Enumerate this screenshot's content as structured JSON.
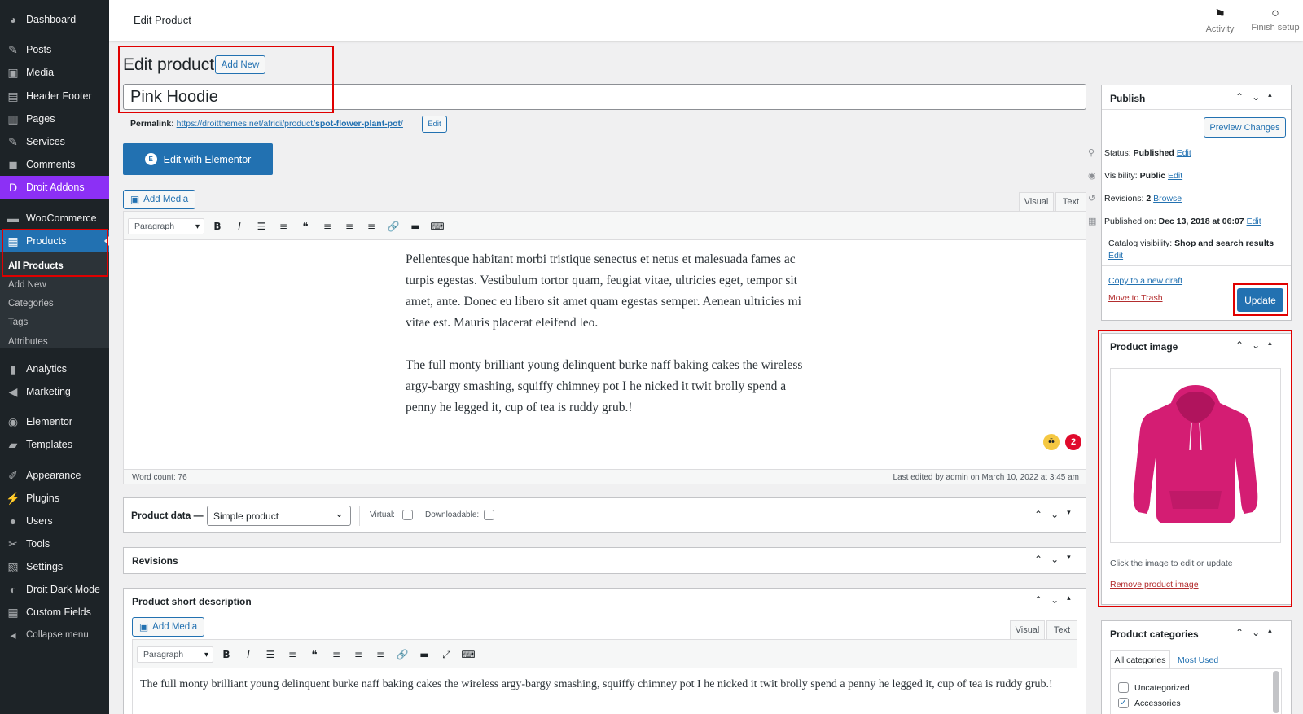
{
  "sidebar": {
    "items": [
      {
        "label": "Dashboard",
        "icon": "dashboard-icon"
      },
      {
        "label": "Posts",
        "icon": "pin-icon"
      },
      {
        "label": "Media",
        "icon": "media-icon"
      },
      {
        "label": "Header Footer",
        "icon": "layout-icon"
      },
      {
        "label": "Pages",
        "icon": "page-icon"
      },
      {
        "label": "Services",
        "icon": "pin-icon"
      },
      {
        "label": "Comments",
        "icon": "comment-icon"
      },
      {
        "label": "Droit Addons",
        "icon": "droit-icon"
      },
      {
        "label": "WooCommerce",
        "icon": "woo-icon"
      },
      {
        "label": "Products",
        "icon": "archive-icon"
      },
      {
        "label": "Analytics",
        "icon": "bar-chart-icon"
      },
      {
        "label": "Marketing",
        "icon": "megaphone-icon"
      },
      {
        "label": "Elementor",
        "icon": "elementor-icon"
      },
      {
        "label": "Templates",
        "icon": "folder-icon"
      },
      {
        "label": "Appearance",
        "icon": "brush-icon"
      },
      {
        "label": "Plugins",
        "icon": "plugin-icon"
      },
      {
        "label": "Users",
        "icon": "user-icon"
      },
      {
        "label": "Tools",
        "icon": "wrench-icon"
      },
      {
        "label": "Settings",
        "icon": "settings-icon"
      },
      {
        "label": "Droit Dark Mode",
        "icon": "droit-dark-icon"
      },
      {
        "label": "Custom Fields",
        "icon": "grid-icon"
      },
      {
        "label": "Collapse menu",
        "icon": "collapse-icon"
      }
    ],
    "products_submenu": [
      "All Products",
      "Add New",
      "Categories",
      "Tags",
      "Attributes"
    ]
  },
  "topbar": {
    "title": "Edit Product",
    "activity_label": "Activity",
    "finish_setup_label": "Finish setup"
  },
  "page": {
    "heading": "Edit product",
    "add_new": "Add New",
    "title_value": "Pink Hoodie",
    "permalink_label": "Permalink:",
    "permalink_url_base": "https://droitthemes.net/afridi/product/",
    "permalink_slug": "spot-flower-plant-pot",
    "permalink_edit": "Edit",
    "elementor_button": "Edit with Elementor",
    "elementor_logo": "E"
  },
  "editor": {
    "add_media": "Add Media",
    "tab_visual": "Visual",
    "tab_text": "Text",
    "format_select": "Paragraph",
    "paragraph1": "Pellentesque habitant morbi tristique senectus et netus et malesuada fames ac turpis egestas. Vestibulum tortor quam, feugiat vitae, ultricies eget, tempor sit amet, ante. Donec eu libero sit amet quam egestas semper. Aenean ultricies mi vitae est. Mauris placerat eleifend leo.",
    "paragraph2": "The full monty brilliant young delinquent burke naff baking cakes the wireless argy-bargy smashing, squiffy chimney pot I he nicked it twit brolly spend a penny he legged it, cup of tea is ruddy grub.!",
    "badge_count": "2",
    "word_count": "Word count: 76",
    "last_edited": "Last edited by admin on March 10, 2022 at 3:45 am"
  },
  "product_data": {
    "label": "Product data —",
    "type_value": "Simple product",
    "virtual_label": "Virtual:",
    "downloadable_label": "Downloadable:"
  },
  "revisions_box": {
    "title": "Revisions"
  },
  "short_description": {
    "title": "Product short description",
    "add_media": "Add Media",
    "tab_visual": "Visual",
    "tab_text": "Text",
    "format_select": "Paragraph",
    "text": "The full monty brilliant young delinquent burke naff baking cakes the wireless argy-bargy smashing, squiffy chimney pot I he nicked it twit brolly spend a penny he legged it, cup of tea is ruddy grub.!"
  },
  "publish": {
    "title": "Publish",
    "preview": "Preview Changes",
    "status_label": "Status:",
    "status_value": "Published",
    "visibility_label": "Visibility:",
    "visibility_value": "Public",
    "revisions_label": "Revisions:",
    "revisions_value": "2",
    "browse": "Browse",
    "published_on_label": "Published on:",
    "published_on_value": "Dec 13, 2018 at 06:07",
    "catalog_label": "Catalog visibility:",
    "catalog_value": "Shop and search results",
    "edit": "Edit",
    "copy_draft": "Copy to a new draft",
    "trash": "Move to Trash",
    "update": "Update"
  },
  "product_image": {
    "title": "Product image",
    "hint": "Click the image to edit or update",
    "remove": "Remove product image",
    "hoodie_color": "#d41d73"
  },
  "categories": {
    "title": "Product categories",
    "tab_all": "All categories",
    "tab_most_used": "Most Used",
    "items": [
      {
        "label": "Uncategorized",
        "checked": false
      },
      {
        "label": "Accessories",
        "checked": true
      }
    ]
  },
  "colors": {
    "accent": "#2271b1",
    "sidebar_bg": "#1d2327",
    "droit": "#8c30f5",
    "highlight_box": "#e00000",
    "trash": "#b32d2e"
  }
}
